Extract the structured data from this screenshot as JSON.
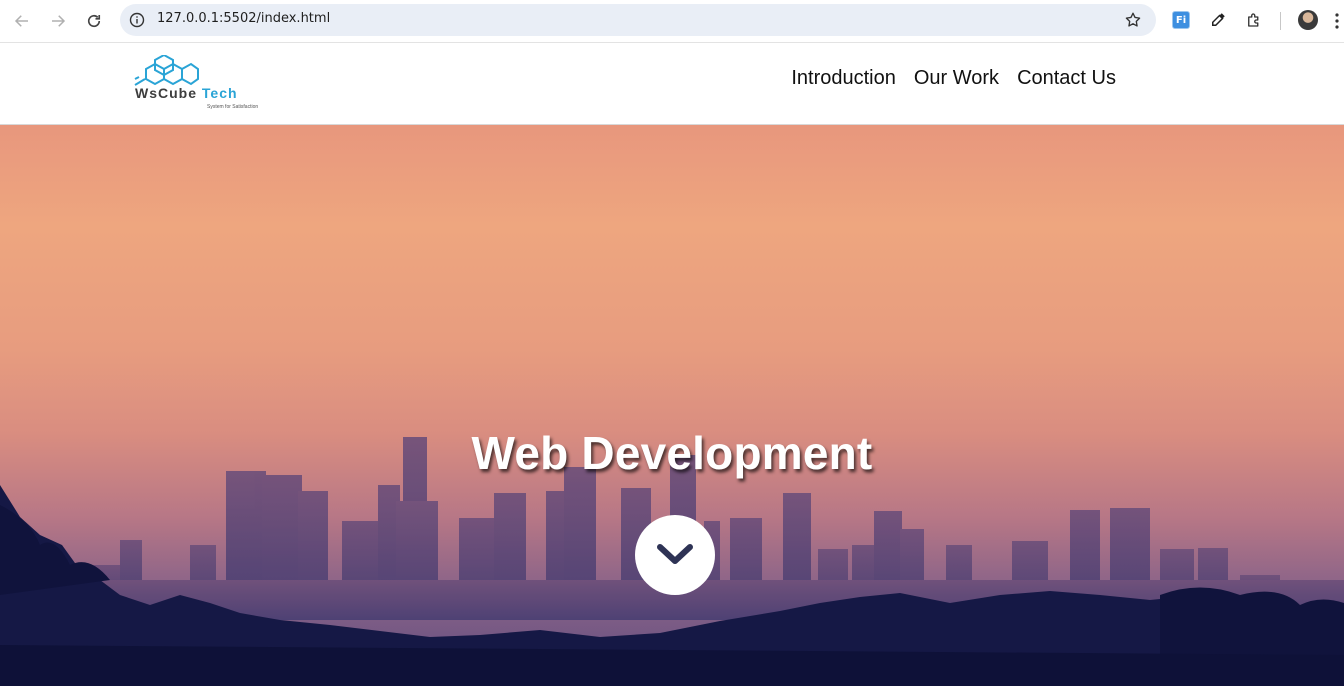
{
  "browser": {
    "url": "127.0.0.1:5502/index.html",
    "extension_badge": "Fi",
    "icons": {
      "back": "arrow-left-icon",
      "forward": "arrow-right-icon",
      "reload": "reload-icon",
      "site_info": "info-icon",
      "bookmark": "star-icon",
      "eyedropper": "eyedropper-icon",
      "extensions": "puzzle-icon",
      "menu": "kebab-menu-icon"
    }
  },
  "site": {
    "logo": {
      "brand_primary": "WsCube",
      "brand_secondary": "Tech",
      "tagline": "System for Satisfaction",
      "colors": {
        "hex": "#2aa4d6",
        "primary_text": "#3d3d3d",
        "secondary_text": "#2aa4d6"
      }
    },
    "nav": {
      "items": [
        {
          "label": "Introduction"
        },
        {
          "label": "Our Work"
        },
        {
          "label": "Contact Us"
        }
      ]
    },
    "hero": {
      "title": "Web Development",
      "scroll_icon": "chevron-down-icon",
      "colors": {
        "sky_top": "#e8977d",
        "haze": "#d98d80",
        "foreground": "#151845",
        "scroll_button": "#ffffff",
        "chevron": "#2e3355"
      }
    }
  }
}
